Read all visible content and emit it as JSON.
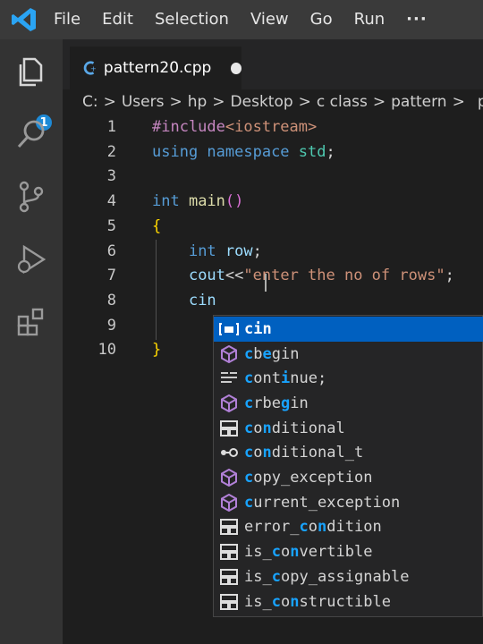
{
  "menubar": {
    "items": [
      "File",
      "Edit",
      "Selection",
      "View",
      "Go",
      "Run",
      "···"
    ]
  },
  "activitybar": {
    "icons": [
      "explorer-icon",
      "search-icon",
      "source-control-icon",
      "run-debug-icon",
      "extensions-icon"
    ],
    "explorer_badge": "1"
  },
  "tab": {
    "label": "pattern20.cpp",
    "modified": true
  },
  "breadcrumb": {
    "items": [
      "C:",
      "Users",
      "hp",
      "Desktop",
      "c class",
      "pattern",
      "p"
    ]
  },
  "editor": {
    "line_numbers": [
      "1",
      "2",
      "3",
      "4",
      "5",
      "6",
      "7",
      "8",
      "9",
      "10"
    ],
    "lines": [
      [
        {
          "t": "#include",
          "c": "pp"
        },
        {
          "t": "<iostream>",
          "c": "str"
        }
      ],
      [
        {
          "t": "using ",
          "c": "kw"
        },
        {
          "t": "namespace ",
          "c": "kw"
        },
        {
          "t": "std",
          "c": "type"
        },
        {
          "t": ";",
          "c": ""
        }
      ],
      [],
      [
        {
          "t": "int ",
          "c": "kw"
        },
        {
          "t": "main",
          "c": "fn"
        },
        {
          "t": "()",
          "c": "par"
        }
      ],
      [
        {
          "t": "{",
          "c": "brace"
        }
      ],
      [
        {
          "t": "    ",
          "c": ""
        },
        {
          "t": "int ",
          "c": "kw"
        },
        {
          "t": "row",
          "c": "var"
        },
        {
          "t": ";",
          "c": ""
        }
      ],
      [
        {
          "t": "    ",
          "c": ""
        },
        {
          "t": "cout",
          "c": "var"
        },
        {
          "t": "<<",
          "c": ""
        },
        {
          "t": "\"enter the no of rows\"",
          "c": "str"
        },
        {
          "t": ";",
          "c": ""
        }
      ],
      [
        {
          "t": "    ",
          "c": ""
        },
        {
          "t": "cin",
          "c": "var"
        }
      ],
      [],
      [
        {
          "t": "}",
          "c": "brace"
        }
      ]
    ]
  },
  "suggestions": {
    "typed": "c",
    "items": [
      {
        "label": "cin",
        "icon": "variable-icon",
        "selected": true,
        "match": [
          0,
          1,
          2
        ]
      },
      {
        "label": "cbegin",
        "icon": "method-icon",
        "selected": false,
        "match": [
          0,
          2
        ]
      },
      {
        "label": "continue;",
        "icon": "snippet-icon",
        "selected": false,
        "match": [
          0,
          4
        ]
      },
      {
        "label": "crbegin",
        "icon": "method-icon",
        "selected": false,
        "match": [
          0,
          4
        ]
      },
      {
        "label": "conditional",
        "icon": "struct-icon",
        "selected": false,
        "match": [
          0,
          2
        ]
      },
      {
        "label": "conditional_t",
        "icon": "typedef-icon",
        "selected": false,
        "match": [
          0,
          2
        ]
      },
      {
        "label": "copy_exception",
        "icon": "method-icon",
        "selected": false,
        "match": [
          0
        ]
      },
      {
        "label": "current_exception",
        "icon": "method-icon",
        "selected": false,
        "match": [
          0
        ]
      },
      {
        "label": "error_condition",
        "icon": "struct-icon",
        "selected": false,
        "match": [
          6,
          8
        ]
      },
      {
        "label": "is_convertible",
        "icon": "struct-icon",
        "selected": false,
        "match": [
          3,
          5
        ]
      },
      {
        "label": "is_copy_assignable",
        "icon": "struct-icon",
        "selected": false,
        "match": [
          3
        ]
      },
      {
        "label": "is_constructible",
        "icon": "struct-icon",
        "selected": false,
        "match": [
          3,
          5
        ]
      }
    ]
  },
  "colors": {
    "accent": "#0060c0",
    "match": "#18a3ff",
    "editor_bg": "#1e1e1e",
    "menubar_bg": "#3a3a3a"
  }
}
